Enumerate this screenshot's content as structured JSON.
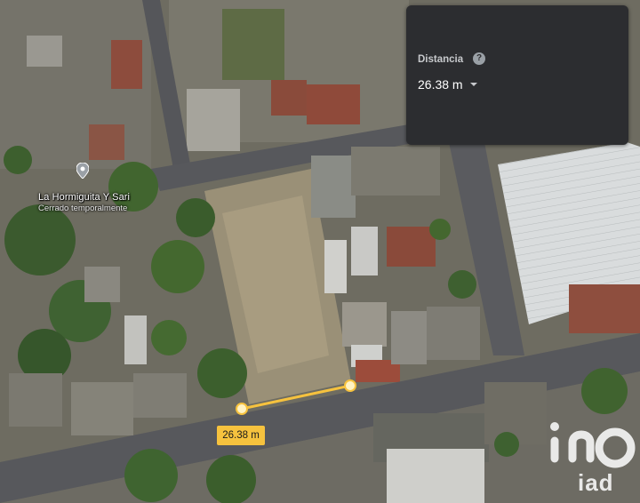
{
  "map": {
    "poi": {
      "name": "La Hormiguita Y Sari",
      "status": "Cerrado temporalmente",
      "icon": "place-pin-icon"
    },
    "measure": {
      "label": "26.38 m",
      "line_color": "#f6c23e"
    }
  },
  "panel": {
    "title": "Distancia",
    "help_icon": "help-circle-icon",
    "value": "26.38 m",
    "dropdown_icon": "caret-down-icon"
  },
  "watermark": {
    "text": "iad",
    "icon": "iad-logo"
  }
}
